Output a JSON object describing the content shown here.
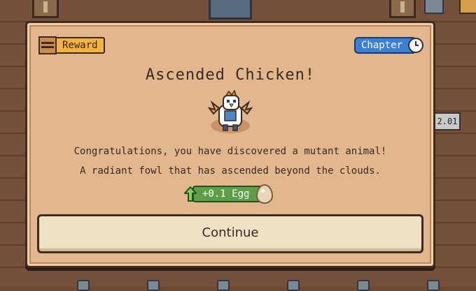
{
  "background": {
    "side_value": "2.01"
  },
  "dialog": {
    "reward_label": "Reward",
    "chapter_label": "Chapter",
    "title": "Ascended Chicken!",
    "animal_icon": "ascended-chicken-icon",
    "description_line1": "Congratulations, you have discovered a mutant animal!",
    "description_line2": "A radiant fowl that has ascended beyond the clouds.",
    "bonus_label": "+0.1 Egg",
    "continue_label": "Continue"
  },
  "colors": {
    "panel": "#e2b78d",
    "reward_tag": "#f2b43d",
    "chapter_tag": "#3c7fd6",
    "bonus_pill": "#5e9e49",
    "button": "#efe1c4"
  }
}
